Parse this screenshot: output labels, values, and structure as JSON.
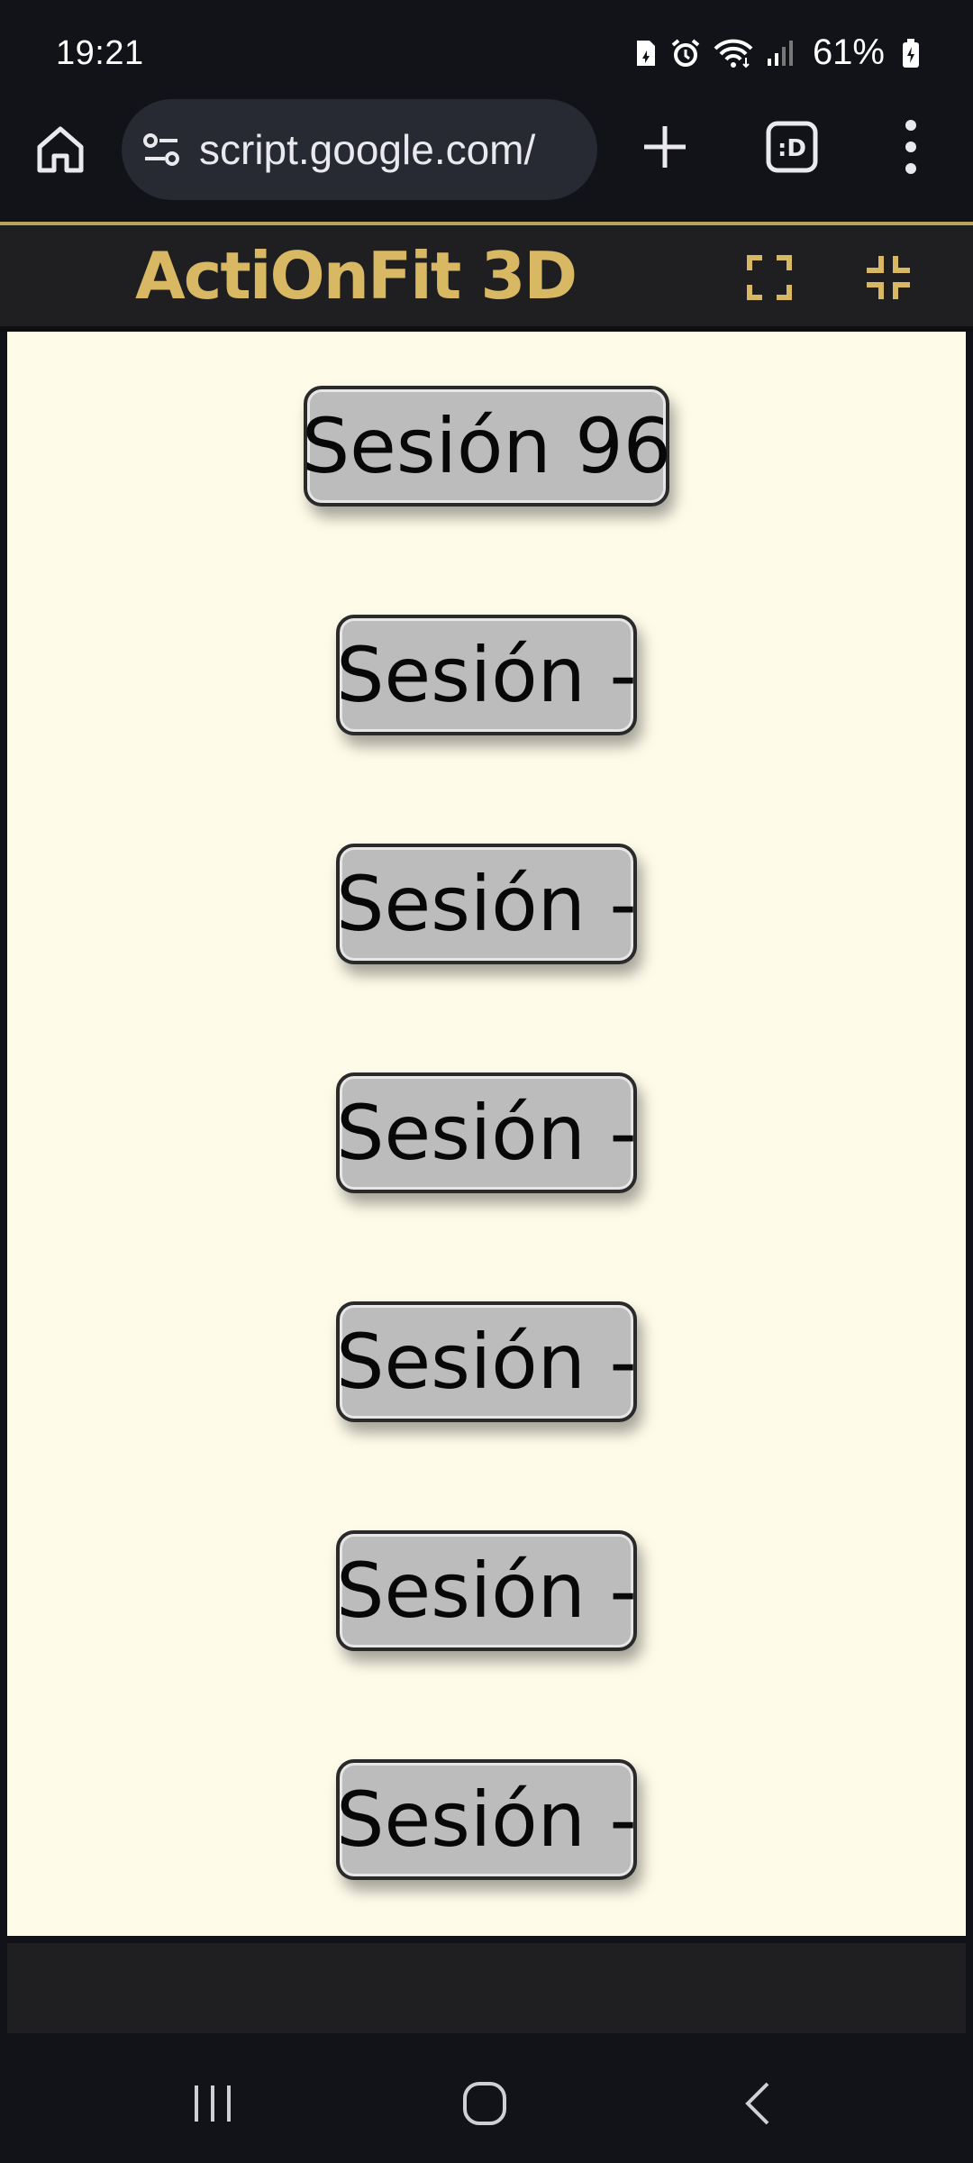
{
  "status_bar": {
    "time": "19:21",
    "battery_percent": "61%",
    "icons": [
      "sim-icon",
      "alarm-icon",
      "wifi-icon",
      "signal-icon",
      "battery-icon"
    ]
  },
  "browser": {
    "url": "script.google.com/",
    "tab_count_label": ":D",
    "icons": [
      "home-icon",
      "site-settings-icon",
      "plus-icon",
      "tabs-icon",
      "more-menu-icon"
    ]
  },
  "app": {
    "title": "ActiOnFit 3D",
    "title_color": "#d8b863",
    "icons": [
      "fullscreen-icon",
      "exit-fullscreen-icon"
    ]
  },
  "sessions": [
    {
      "label": "Sesión 96"
    },
    {
      "label": "Sesión -"
    },
    {
      "label": "Sesión -"
    },
    {
      "label": "Sesión -"
    },
    {
      "label": "Sesión -"
    },
    {
      "label": "Sesión -"
    },
    {
      "label": "Sesión -"
    }
  ],
  "colors": {
    "panel_background": "#fefbe9",
    "button_face": "#bcbcbc",
    "header_background": "#1f1f21",
    "accent_line": "#b9a35a"
  },
  "nav_bar": {
    "icons": [
      "recents-icon",
      "home-circle-icon",
      "back-icon"
    ]
  }
}
